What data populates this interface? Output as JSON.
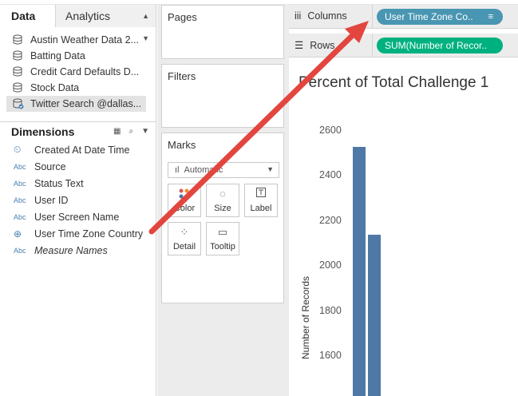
{
  "tabs": {
    "data": "Data",
    "analytics": "Analytics"
  },
  "sources": [
    {
      "label": "Austin Weather Data 2...",
      "selected": false
    },
    {
      "label": "Batting Data",
      "selected": false
    },
    {
      "label": "Credit Card Defaults D...",
      "selected": false
    },
    {
      "label": "Stock Data",
      "selected": false
    },
    {
      "label": "Twitter Search @dallas...",
      "selected": true
    }
  ],
  "dimensions": {
    "title": "Dimensions",
    "fields": [
      {
        "type": "date",
        "label": "Created At Date Time"
      },
      {
        "type": "Abc",
        "label": "Source"
      },
      {
        "type": "Abc",
        "label": "Status Text"
      },
      {
        "type": "Abc",
        "label": "User ID"
      },
      {
        "type": "Abc",
        "label": "User Screen Name"
      },
      {
        "type": "geo",
        "label": "User Time Zone Country"
      },
      {
        "type": "Abc",
        "label": "Measure Names"
      }
    ]
  },
  "cards": {
    "pages": "Pages",
    "filters": "Filters",
    "marks": "Marks",
    "mark_type": "Automatic",
    "buttons": {
      "color": "Color",
      "size": "Size",
      "label": "Label",
      "detail": "Detail",
      "tooltip": "Tooltip"
    }
  },
  "shelves": {
    "columns": {
      "label": "Columns",
      "pill": "User Time Zone Co.."
    },
    "rows": {
      "label": "Rows",
      "pill": "SUM(Number of Recor.."
    }
  },
  "view": {
    "title": "Percent of Total Challenge 1",
    "yaxis_label": "Number of Records"
  },
  "chart_data": {
    "type": "bar",
    "title": "Percent of Total Challenge 1",
    "ylabel": "Number of Records",
    "yticks": [
      1600,
      1800,
      2000,
      2200,
      2400,
      2600
    ],
    "ylim": [
      1400,
      2680
    ],
    "values": [
      2530,
      2140
    ],
    "colors": {
      "bar": "#4e79a7"
    },
    "grid": false
  },
  "colors": {
    "dimension_pill": "#4996b2",
    "measure_pill": "#00b180",
    "annotation_arrow": "#e2463f"
  }
}
